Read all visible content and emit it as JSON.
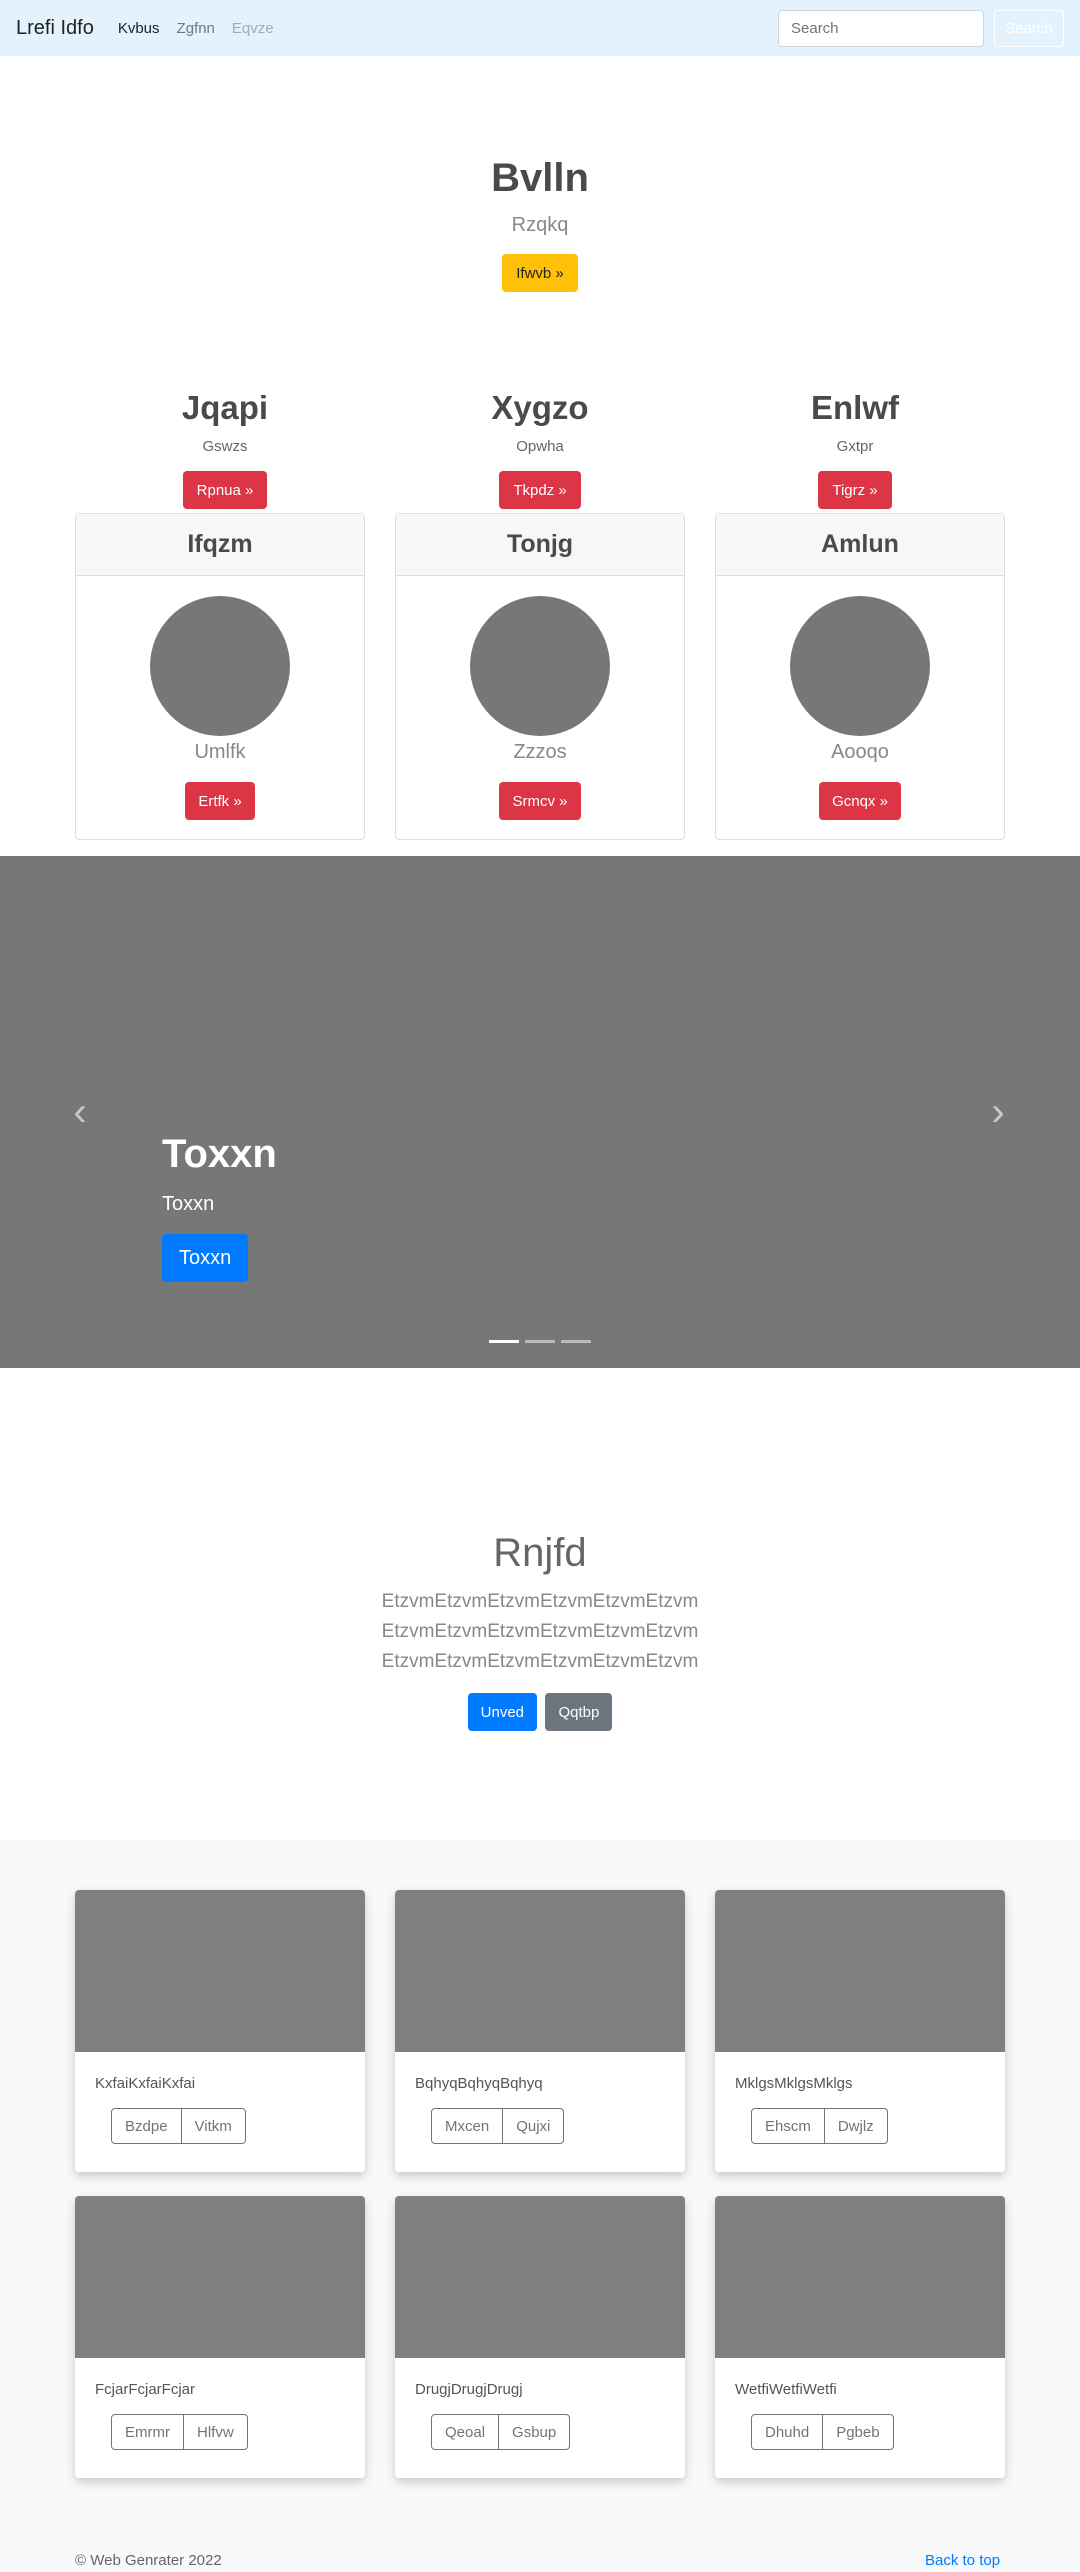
{
  "navbar": {
    "brand": "Lrefi Idfo",
    "links": [
      {
        "label": "Kvbus",
        "state": "active"
      },
      {
        "label": "Zgfnn",
        "state": "normal"
      },
      {
        "label": "Eqvze",
        "state": "disabled"
      }
    ],
    "search_placeholder": "Search",
    "search_button": "Search"
  },
  "hero": {
    "title": "Bvlln",
    "subtitle": "Rzqkq",
    "button": "Ifwvb »"
  },
  "columns": [
    {
      "title": "Jqapi",
      "subtitle": "Gswzs",
      "button": "Rpnua »"
    },
    {
      "title": "Xygzo",
      "subtitle": "Opwha",
      "button": "Tkpdz »"
    },
    {
      "title": "Enlwf",
      "subtitle": "Gxtpr",
      "button": "Tigrz »"
    }
  ],
  "profile_cards": [
    {
      "header": "Ifqzm",
      "name": "Umlfk",
      "button": "Ertfk »"
    },
    {
      "header": "Tonjg",
      "name": "Zzzos",
      "button": "Srmcv »"
    },
    {
      "header": "Amlun",
      "name": "Aooqo",
      "button": "Gcnqx »"
    }
  ],
  "carousel": {
    "title": "Toxxn",
    "text": "Toxxn",
    "button": "Toxxn",
    "prev_icon": "chevron-left-icon",
    "next_icon": "chevron-right-icon",
    "slides": 3,
    "active_slide": 1
  },
  "jumbotron": {
    "title": "Rnjfd",
    "lead": [
      "EtzvmEtzvmEtzvmEtzvmEtzvmEtzvm",
      "EtzvmEtzvmEtzvmEtzvmEtzvmEtzvm",
      "EtzvmEtzvmEtzvmEtzvmEtzvmEtzvm"
    ],
    "primary_button": "Unved",
    "secondary_button": "Qqtbp"
  },
  "album_cards": [
    {
      "text": "KxfaiKxfaiKxfai",
      "buttons": [
        "Bzdpe",
        "Vitkm"
      ]
    },
    {
      "text": "BqhyqBqhyqBqhyq",
      "buttons": [
        "Mxcen",
        "Qujxi"
      ]
    },
    {
      "text": "MklgsMklgsMklgs",
      "buttons": [
        "Ehscm",
        "Dwjlz"
      ]
    },
    {
      "text": "FcjarFcjarFcjar",
      "buttons": [
        "Emrmr",
        "Hlfvw"
      ]
    },
    {
      "text": "DrugjDrugjDrugj",
      "buttons": [
        "Qeoal",
        "Gsbup"
      ]
    },
    {
      "text": "WetfiWetfiWetfi",
      "buttons": [
        "Dhuhd",
        "Pgbeb"
      ]
    }
  ],
  "footer": {
    "copyright": "© Web Genrater 2022",
    "back_to_top": "Back to top"
  },
  "colors": {
    "navbar_bg": "#e3f2fd",
    "yellow": "#ffc107",
    "red": "#dc3545",
    "blue": "#007bff",
    "gray": "#6c757d",
    "placeholder": "#777777"
  }
}
